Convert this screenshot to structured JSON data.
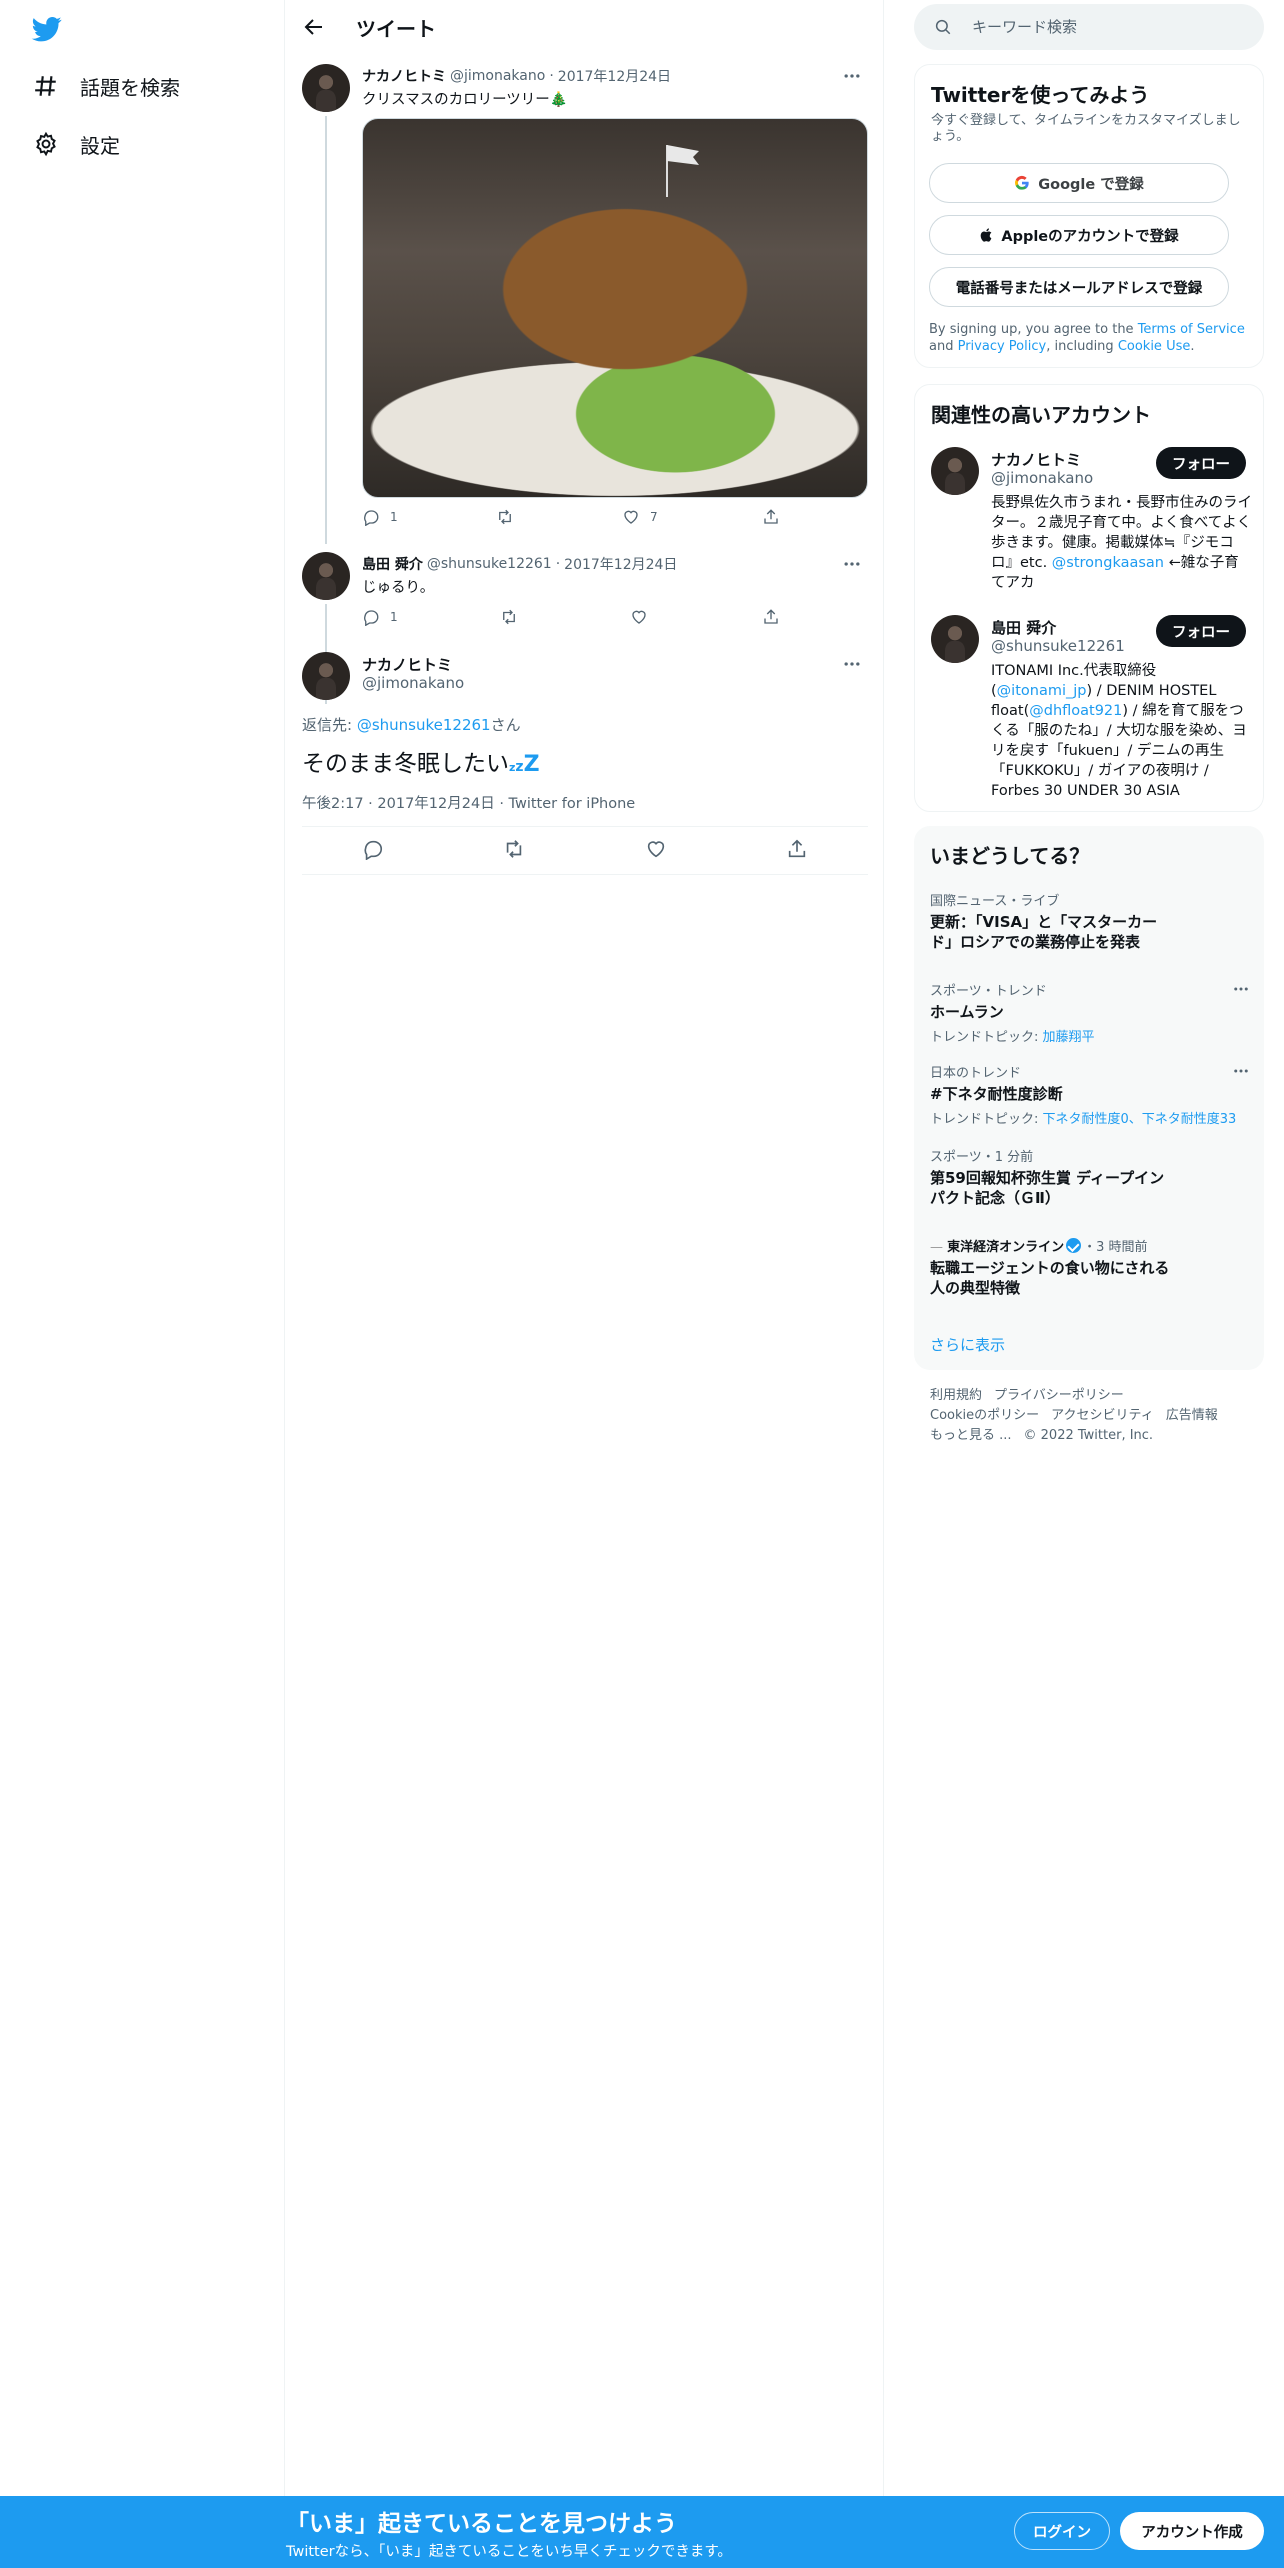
{
  "nav": {
    "items": [
      {
        "label": "話題を検索",
        "icon": "hashtag-icon"
      },
      {
        "label": "設定",
        "icon": "gear-icon"
      }
    ]
  },
  "header": {
    "title": "ツイート"
  },
  "thread": {
    "tweet1": {
      "name": "ナカノヒトミ",
      "handle": "@jimonakano",
      "date": "2017年12月24日",
      "text": "クリスマスのカロリーツリー🎄",
      "replies": "1",
      "likes": "7"
    },
    "tweet2": {
      "name": "島田 舜介",
      "handle": "@shunsuke12261",
      "date": "2017年12月24日",
      "text": "じゅるり。",
      "replies": "1"
    },
    "focus": {
      "name": "ナカノヒトミ",
      "handle": "@jimonakano",
      "reply_prefix": "返信先: ",
      "reply_handle": "@shunsuke12261",
      "reply_suffix": "さん",
      "text": "そのまま冬眠したい",
      "zzz": [
        "z",
        "z",
        "Z"
      ],
      "time": "午後2:17",
      "date": "2017年12月24日",
      "source": "Twitter for iPhone"
    }
  },
  "search": {
    "placeholder": "キーワード検索"
  },
  "signup_card": {
    "title": "Twitterを使ってみよう",
    "subtitle": "今すぐ登録して、タイムラインをカスタマイズしましょう。",
    "google": "Google で登録",
    "apple": "Appleのアカウントで登録",
    "phone": "電話番号またはメールアドレスで登録",
    "legal_1": "By signing up, you agree to the ",
    "legal_terms": "Terms of Service",
    "legal_2": " and ",
    "legal_privacy": "Privacy Policy",
    "legal_3": ", including ",
    "legal_cookie": "Cookie Use",
    "legal_4": "."
  },
  "related": {
    "title": "関連性の高いアカウント",
    "follow_label": "フォロー",
    "accounts": [
      {
        "name": "ナカノヒトミ",
        "handle": "@jimonakano",
        "bio_1": "長野県佐久市うまれ・長野市住みのライター。２歳児子育て中。よく食べてよく歩きます。健康。掲載媒体≒『ジモコロ』etc. ",
        "bio_link": "@strongkaasan",
        "bio_2": " ←雑な子育てアカ"
      },
      {
        "name": "島田 舜介",
        "handle": "@shunsuke12261",
        "bio_1": "ITONAMI Inc.代表取締役(",
        "bio_link1": "@itonami_jp",
        "bio_2": ") / DENIM HOSTEL float(",
        "bio_link2": "@dhfloat921",
        "bio_3": ") / 綿を育て服をつくる「服のたね」/ 大切な服を染め、ヨリを戻す「fukuen」/ デニムの再生「FUKKOKU」/ ガイアの夜明け / Forbes 30 UNDER 30 ASIA"
      }
    ]
  },
  "trends": {
    "title": "いまどうしてる？",
    "items": [
      {
        "category": "国際ニュース・ライブ",
        "name": "更新：「VISA」と「マスターカード」ロシアでの業務停止を発表"
      },
      {
        "category": "スポーツ・トレンド",
        "name": "ホームラン",
        "sub_prefix": "トレンドトピック: ",
        "sub_link": "加藤翔平"
      },
      {
        "category": "日本のトレンド",
        "name": "#下ネタ耐性度診断",
        "sub_prefix": "トレンドトピック: ",
        "sub_link": "下ネタ耐性度0、下ネタ耐性度33"
      },
      {
        "category": "スポーツ・1 分前",
        "name": "第59回報知杯弥生賞 ディープインパクト記念（ＧⅡ）"
      },
      {
        "source": "東洋経済オンライン",
        "time": "・3 時間前",
        "name": "転職エージェントの食い物にされる人の典型特徴"
      }
    ],
    "show_more": "さらに表示"
  },
  "footer": {
    "links": [
      "利用規約",
      "プライバシーポリシー",
      "Cookieのポリシー",
      "アクセシビリティ",
      "広告情報",
      "もっと見る ..."
    ],
    "copyright": "© 2022 Twitter, Inc."
  },
  "bottom_bar": {
    "title": "「いま」起きていることを見つけよう",
    "subtitle": "Twitterなら、「いま」起きていることをいち早くチェックできます。",
    "login": "ログイン",
    "signup": "アカウント作成"
  },
  "colors": {
    "brand": "#1d9bf0",
    "text": "#0f1419",
    "muted": "#536471"
  }
}
